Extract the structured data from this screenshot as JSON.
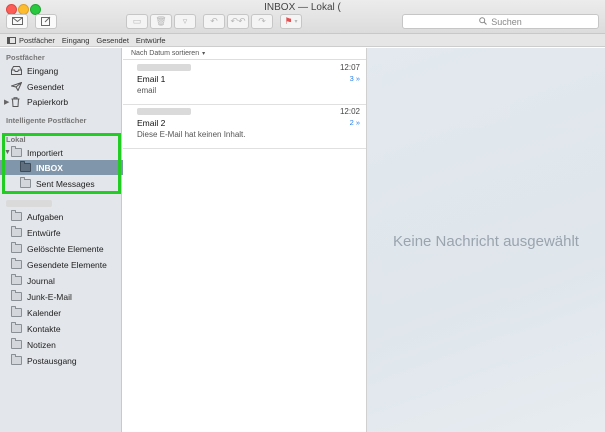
{
  "window": {
    "title": "INBOX — Lokal ("
  },
  "toolbar": {
    "search_placeholder": "Suchen",
    "search_icon": "magnifier-icon",
    "buttons": [
      "new-message-icon",
      "compose-icon",
      "archive-icon",
      "delete-icon",
      "junk-icon",
      "reply-icon",
      "reply-all-icon",
      "forward-icon",
      "flag-icon"
    ]
  },
  "favorites": {
    "mailboxes_label": "Postfächer",
    "items": [
      "Eingang",
      "Gesendet",
      "Entwürfe"
    ]
  },
  "sidebar": {
    "postfaecher_header": "Postfächer",
    "postfaecher": [
      {
        "label": "Eingang",
        "icon": "inbox-tray-icon"
      },
      {
        "label": "Gesendet",
        "icon": "paper-plane-icon"
      },
      {
        "label": "Papierkorb",
        "icon": "trash-icon"
      }
    ],
    "smart_header": "Intelligente Postfächer",
    "local_header": "Lokal",
    "imported_label": "Importiert",
    "imported_children": [
      {
        "label": "INBOX",
        "selected": true
      },
      {
        "label": "Sent Messages",
        "selected": false
      }
    ],
    "other_folders": [
      "Aufgaben",
      "Entwürfe",
      "Gelöschte Elemente",
      "Gesendete Elemente",
      "Journal",
      "Junk-E-Mail",
      "Kalender",
      "Kontakte",
      "Notizen",
      "Postausgang"
    ]
  },
  "message_list": {
    "sort_label": "Nach Datum sortieren",
    "messages": [
      {
        "time": "12:07",
        "count": "3 »",
        "subject": "Email 1",
        "preview": "email"
      },
      {
        "time": "12:02",
        "count": "2 »",
        "subject": "Email 2",
        "preview": "Diese E-Mail hat keinen Inhalt."
      }
    ]
  },
  "preview": {
    "empty_text": "Keine Nachricht ausgewählt"
  },
  "colors": {
    "selection": "#8096aa",
    "highlight_box": "#22cc22",
    "accent_link": "#2a7fe8"
  }
}
